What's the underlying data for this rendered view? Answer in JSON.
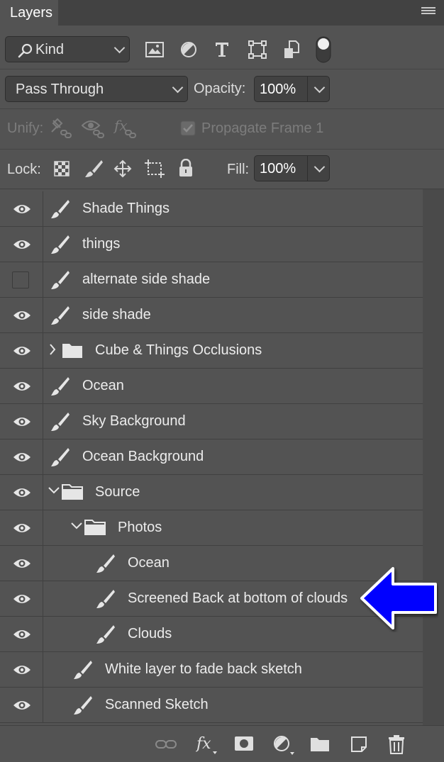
{
  "panel": {
    "tab_label": "Layers",
    "menu_icon": "hamburger-icon"
  },
  "filter": {
    "kind_label": "Kind",
    "icons": [
      "image-filter-icon",
      "adjustment-filter-icon",
      "type-filter-icon",
      "shape-filter-icon",
      "smart-object-filter-icon",
      "filter-toggle-icon"
    ]
  },
  "blend": {
    "mode": "Pass Through",
    "opacity_label": "Opacity:",
    "opacity_value": "100%"
  },
  "unify": {
    "label": "Unify:",
    "propagate_label": "Propagate Frame 1"
  },
  "lock": {
    "label": "Lock:",
    "fill_label": "Fill:",
    "fill_value": "100%"
  },
  "layers": [
    {
      "name": "Shade Things",
      "visible": true,
      "type": "paint"
    },
    {
      "name": "things",
      "visible": true,
      "type": "paint"
    },
    {
      "name": "alternate side shade",
      "visible": false,
      "type": "paint"
    },
    {
      "name": "side shade",
      "visible": true,
      "type": "paint"
    },
    {
      "name": "Cube & Things Occlusions",
      "visible": true,
      "type": "group",
      "expanded": false
    },
    {
      "name": "Ocean",
      "visible": true,
      "type": "paint"
    },
    {
      "name": "Sky Background",
      "visible": true,
      "type": "paint"
    },
    {
      "name": "Ocean Background",
      "visible": true,
      "type": "paint"
    },
    {
      "name": "Source",
      "visible": true,
      "type": "group",
      "expanded": true
    },
    {
      "name": "Photos",
      "visible": true,
      "type": "group",
      "expanded": true
    },
    {
      "name": "Ocean",
      "visible": true,
      "type": "paint"
    },
    {
      "name": "Screened Back at bottom of clouds",
      "visible": true,
      "type": "paint"
    },
    {
      "name": "Clouds",
      "visible": true,
      "type": "paint"
    },
    {
      "name": "White layer to fade back sketch",
      "visible": true,
      "type": "paint"
    },
    {
      "name": "Scanned Sketch",
      "visible": true,
      "type": "paint"
    }
  ],
  "colors": {
    "panel_bg": "#535353",
    "field_bg": "#424242",
    "arrow": "#0000ff"
  }
}
